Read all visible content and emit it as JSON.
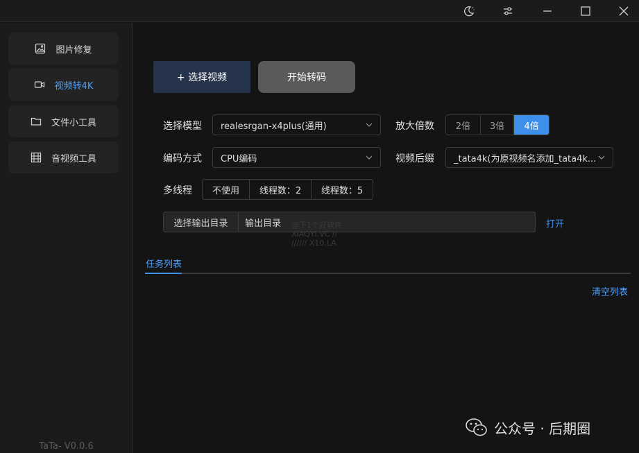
{
  "app": {
    "version": "TaTa- V0.0.6"
  },
  "sidebar": {
    "items": [
      {
        "label": "图片修复",
        "icon": "image-icon",
        "active": false
      },
      {
        "label": "视频转4K",
        "icon": "video-camera-icon",
        "active": true
      },
      {
        "label": "文件小工具",
        "icon": "folder-icon",
        "active": false
      },
      {
        "label": "音视频工具",
        "icon": "film-icon",
        "active": false
      }
    ]
  },
  "toolbar": {
    "select_video_label": "+ 选择视频",
    "start_label": "开始转码"
  },
  "form": {
    "model_label": "选择模型",
    "model_value": "realesrgan-x4plus(通用)",
    "scale_label": "放大倍数",
    "scale_options": [
      "2倍",
      "3倍",
      "4倍"
    ],
    "scale_selected": "4倍",
    "encode_label": "编码方式",
    "encode_value": "CPU编码",
    "suffix_label": "视频后缀",
    "suffix_value": "_tata4k(为原视频名添加_tata4k...",
    "threads_label": "多线程",
    "thread_options": [
      "不使用",
      "线程数：2",
      "线程数：5"
    ],
    "output_button": "选择输出目录",
    "output_placeholder": "输出目录",
    "open_link": "打开"
  },
  "tasks": {
    "tab_label": "任务列表",
    "clear_label": "清空列表"
  },
  "watermark": {
    "line1": "@下1个好软件",
    "line2": "XIAQYI.VC //",
    "line3": "////// X10.LA"
  },
  "footer_badge": {
    "text": "公众号 · 后期圈"
  },
  "colors": {
    "accent": "#3d8fea",
    "background": "#141414",
    "sidebar": "#1b1b1b",
    "select_video_button": "#25344b",
    "start_button": "#5a5a5a"
  }
}
